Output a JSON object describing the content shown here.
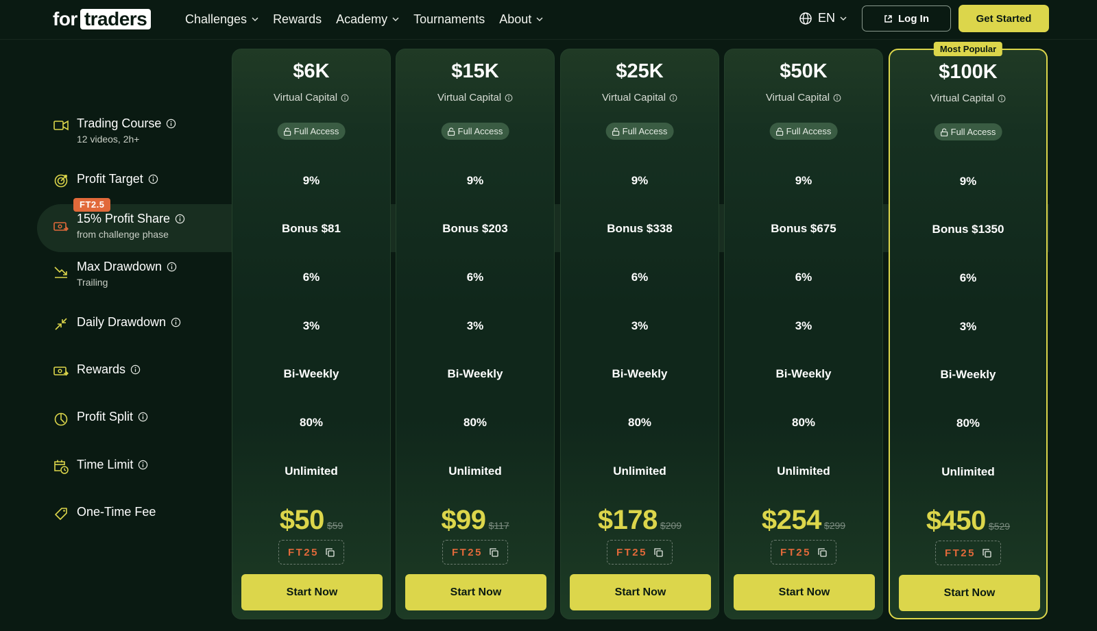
{
  "nav": {
    "logo_for": "for",
    "logo_traders": "traders",
    "menu": [
      {
        "label": "Challenges",
        "dropdown": true
      },
      {
        "label": "Rewards",
        "dropdown": false
      },
      {
        "label": "Academy",
        "dropdown": true
      },
      {
        "label": "Tournaments",
        "dropdown": false
      },
      {
        "label": "About",
        "dropdown": true
      }
    ],
    "language": "EN",
    "login": "Log In",
    "get_started": "Get Started"
  },
  "features": [
    {
      "key": "trading-course",
      "title": "Trading Course",
      "sub": "12 videos, 2h+",
      "icon": "video-icon",
      "info": true
    },
    {
      "key": "profit-target",
      "title": "Profit Target",
      "sub": "",
      "icon": "target-icon",
      "info": true
    },
    {
      "key": "profit-share",
      "title": "15% Profit Share",
      "sub": "from challenge phase",
      "icon": "cash-icon",
      "info": true
    },
    {
      "key": "max-drawdown",
      "title": "Max Drawdown",
      "sub": "Trailing",
      "icon": "trend-down-icon",
      "info": true
    },
    {
      "key": "daily-drawdown",
      "title": "Daily Drawdown",
      "sub": "",
      "icon": "arrows-in-icon",
      "info": true
    },
    {
      "key": "rewards",
      "title": "Rewards",
      "sub": "",
      "icon": "money-icon",
      "info": true
    },
    {
      "key": "profit-split",
      "title": "Profit Split",
      "sub": "",
      "icon": "pie-icon",
      "info": true
    },
    {
      "key": "time-limit",
      "title": "Time Limit",
      "sub": "",
      "icon": "calendar-clock-icon",
      "info": true
    },
    {
      "key": "one-time-fee",
      "title": "One-Time Fee",
      "sub": "",
      "icon": "tag-icon",
      "info": false
    }
  ],
  "profit_share_tag": "FT2.5",
  "virtual_capital_label": "Virtual Capital",
  "full_access_label": "Full Access",
  "start_label": "Start Now",
  "popular_label": "Most Popular",
  "colors": {
    "accent": "#dcd64b",
    "promo": "#e1693a",
    "background": "#0a1a12"
  },
  "plans": [
    {
      "capital": "$6K",
      "target": "9%",
      "bonus": "Bonus $81",
      "max_dd": "6%",
      "daily_dd": "3%",
      "rewards": "Bi-Weekly",
      "split": "80%",
      "time": "Unlimited",
      "price": "$50",
      "old_price": "$59",
      "code": "FT25",
      "popular": false
    },
    {
      "capital": "$15K",
      "target": "9%",
      "bonus": "Bonus $203",
      "max_dd": "6%",
      "daily_dd": "3%",
      "rewards": "Bi-Weekly",
      "split": "80%",
      "time": "Unlimited",
      "price": "$99",
      "old_price": "$117",
      "code": "FT25",
      "popular": false
    },
    {
      "capital": "$25K",
      "target": "9%",
      "bonus": "Bonus $338",
      "max_dd": "6%",
      "daily_dd": "3%",
      "rewards": "Bi-Weekly",
      "split": "80%",
      "time": "Unlimited",
      "price": "$178",
      "old_price": "$209",
      "code": "FT25",
      "popular": false
    },
    {
      "capital": "$50K",
      "target": "9%",
      "bonus": "Bonus $675",
      "max_dd": "6%",
      "daily_dd": "3%",
      "rewards": "Bi-Weekly",
      "split": "80%",
      "time": "Unlimited",
      "price": "$254",
      "old_price": "$299",
      "code": "FT25",
      "popular": false
    },
    {
      "capital": "$100K",
      "target": "9%",
      "bonus": "Bonus $1350",
      "max_dd": "6%",
      "daily_dd": "3%",
      "rewards": "Bi-Weekly",
      "split": "80%",
      "time": "Unlimited",
      "price": "$450",
      "old_price": "$529",
      "code": "FT25",
      "popular": true
    }
  ]
}
